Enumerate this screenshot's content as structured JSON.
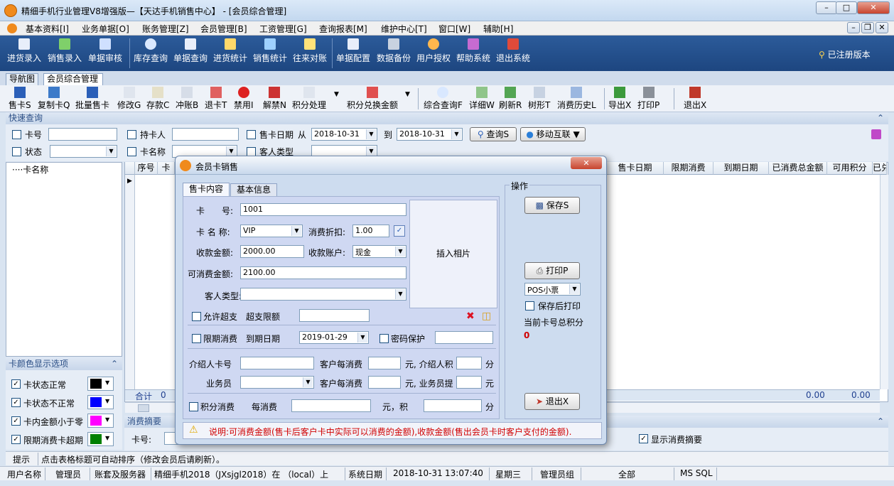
{
  "window": {
    "title": "精细手机行业管理V8增强版—【天达手机销售中心】 - [会员综合管理]"
  },
  "menu": [
    "基本资料[I]",
    "业务单据[O]",
    "账务管理[Z]",
    "会员管理[B]",
    "工资管理[G]",
    "查询报表[M]",
    "维护中心[T]",
    "窗口[W]",
    "辅助[H]"
  ],
  "toolbar1": [
    "进货录入",
    "销售录入",
    "单据审核",
    "库存查询",
    "单据查询",
    "进货统计",
    "销售统计",
    "往来对账",
    "单据配置",
    "数据备份",
    "用户授权",
    "帮助系统",
    "退出系统"
  ],
  "registered": "已注册版本",
  "tabs": [
    "导航图",
    "会员综合管理"
  ],
  "toolbar2": [
    "售卡S",
    "复制卡Q",
    "批量售卡",
    "修改G",
    "存款C",
    "冲账B",
    "退卡T",
    "禁用I",
    "解禁N",
    "积分处理",
    "积分兑换金额",
    "综合查询F",
    "详细W",
    "刷新R",
    "树形T",
    "消费历史L",
    "导出X",
    "打印P",
    "退出X"
  ],
  "quick": {
    "header": "快速查询",
    "card_no": "卡号",
    "holder": "持卡人",
    "sale_date": "售卡日期",
    "from": "从",
    "date_from": "2018-10-31",
    "to": "到",
    "date_to": "2018-10-31",
    "query": "查询S",
    "mobile": "移动互联",
    "status": "状态",
    "card_name": "卡名称",
    "customer_type": "客人类型"
  },
  "tree": {
    "root": "卡名称"
  },
  "grid": {
    "columns": [
      "序号",
      "卡",
      "售卡日期",
      "限期消费",
      "到期日期",
      "已消费总金额",
      "可用积分",
      "已兑"
    ],
    "total_label": "合计",
    "total_count": "0",
    "total_spent": "0.00",
    "total_points": "0.00"
  },
  "color_options": {
    "header": "卡颜色显示选项",
    "items": [
      {
        "label": "卡状态正常",
        "color": "#000000"
      },
      {
        "label": "卡状态不正常",
        "color": "#0000ff"
      },
      {
        "label": "卡内金额小于零",
        "color": "#ff00ff"
      },
      {
        "label": "限期消费卡超期",
        "color": "#008000"
      }
    ]
  },
  "summary": {
    "header": "消费摘要",
    "card_no": "卡号:",
    "show_summary": "显示消费摘要"
  },
  "tip": {
    "label": "提示",
    "text": "点击表格标题可自动排序（修改会员后请刷新）。"
  },
  "status": {
    "user_label": "用户名称",
    "user": "管理员",
    "account_label": "账套及服务器",
    "account": "精细手机2018（JXsjgl2018）在 （local）上",
    "date_label": "系统日期",
    "date": "2018-10-31",
    "time": "13:07:40",
    "weekday": "星期三",
    "group": "管理员组",
    "scope": "全部",
    "db": "MS SQL"
  },
  "dialog": {
    "title": "会员卡销售",
    "tabs": [
      "售卡内容",
      "基本信息"
    ],
    "card_no_label": "卡　　号:",
    "card_no": "1001",
    "card_name_label": "卡 名 称:",
    "card_name": "VIP",
    "discount_label": "消费折扣:",
    "discount": "1.00",
    "amount_label": "收款金额:",
    "amount": "2000.00",
    "account_label": "收款账户:",
    "account": "现金",
    "consumable_label": "可消费金额:",
    "consumable": "2100.00",
    "cust_type_label": "客人类型:",
    "photo": "插入相片",
    "allow_overdraft": "允许超支",
    "overdraft_limit": "超支限额",
    "limited": "限期消费",
    "expire_label": "到期日期",
    "expire": "2019-01-29",
    "password": "密码保护",
    "referrer": "介绍人卡号",
    "per_consume1": "客户每消费",
    "ref_points": "元, 介绍人积",
    "fen1": "分",
    "salesman": "业务员",
    "per_consume2": "客户每消费",
    "sales_cut": "元, 业务员提",
    "yuan": "元",
    "points_consume": "积分消费",
    "per_consume3": "每消费",
    "yuan_points": "元，积",
    "fen2": "分",
    "ops": "操作",
    "save": "保存S",
    "print": "打印P",
    "print_type": "POS小票",
    "print_after_save": "保存后打印",
    "total_points_label": "当前卡号总积分",
    "total_points": "0",
    "exit": "退出X",
    "note": "说明:可消费金额(售卡后客户卡中实际可以消费的金额),收款金额(售出会员卡时客户支付的金额)."
  }
}
